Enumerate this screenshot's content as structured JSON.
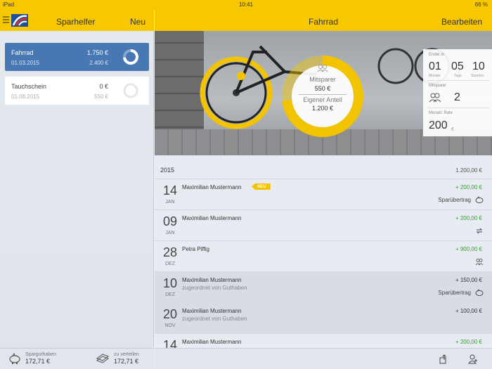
{
  "statusbar": {
    "device": "iPad",
    "wifi": "wifi-icon",
    "time": "10:41",
    "battery": "66 %"
  },
  "sidebar": {
    "title": "Sparhelfer",
    "new_button": "Neu",
    "cards": [
      {
        "name": "Fahrrad",
        "date": "01.03.2015",
        "amount": "1.750 €",
        "goal": "2.400 €",
        "progress": 0.73,
        "selected": true
      },
      {
        "name": "Tauchschein",
        "date": "01.08.2015",
        "amount": "0 €",
        "goal": "550 €",
        "progress": 0.0,
        "selected": false
      }
    ],
    "footer": {
      "savings_label": "Sparguthaben",
      "savings_value": "172,71 €",
      "distribute_label": "zu verteilen",
      "distribute_value": "172,71 €"
    }
  },
  "detail": {
    "title": "Fahrrad",
    "edit_button": "Bearbeiten",
    "hero": {
      "co_savers_label": "Mitsparer",
      "co_savers_amount": "550 €",
      "own_share_label": "Eigener Anteil",
      "own_share_amount": "1.200 €",
      "progress": 0.73
    },
    "info": {
      "ends_in_label": "Endet in",
      "months": "01",
      "months_label": "Monate",
      "days": "05",
      "days_label": "Tage",
      "hours": "10",
      "hours_label": "Stunden",
      "co_savers_label": "Mitsparer",
      "co_savers_count": "2",
      "monthly_rate_label": "Monatl. Rate",
      "monthly_rate_value": "200",
      "monthly_rate_unit": "€"
    },
    "year": {
      "label": "2015",
      "total": "1.200,00 €"
    },
    "entries": [
      {
        "day": "14",
        "month": "JAN",
        "name": "Maximilian Mustermann",
        "sub": "",
        "amount": "+ 200,00 €",
        "amount_color": "green",
        "label": "Sparübertrag",
        "icon": "piggy-bank-icon",
        "badge": "NEU",
        "shaded": false
      },
      {
        "day": "09",
        "month": "JAN",
        "name": "Maximilian Mustermann",
        "sub": "",
        "amount": "+ 200,00 €",
        "amount_color": "green",
        "label": "",
        "icon": "repeat-icon",
        "badge": "",
        "shaded": false
      },
      {
        "day": "28",
        "month": "DEZ",
        "name": "Petra Piffig",
        "sub": "",
        "amount": "+ 900,00 €",
        "amount_color": "green",
        "label": "",
        "icon": "group-icon",
        "badge": "",
        "shaded": false
      },
      {
        "day": "10",
        "month": "DEZ",
        "name": "Maximilian Mustermann",
        "sub": "zugeordnet von Guthaben",
        "amount": "+ 150,00 €",
        "amount_color": "dark",
        "label": "Sparübertrag",
        "icon": "piggy-bank-icon",
        "badge": "",
        "shaded": true
      },
      {
        "day": "20",
        "month": "NOV",
        "name": "Maximilian Mustermann",
        "sub": "zugeordnet von Guthaben",
        "amount": "+ 100,00 €",
        "amount_color": "dark",
        "label": "",
        "icon": "",
        "badge": "",
        "shaded": true
      },
      {
        "day": "14",
        "month": "",
        "name": "Maximilian Mustermann",
        "sub": "",
        "amount": "+ 200,00 €",
        "amount_color": "green",
        "label": "",
        "icon": "",
        "badge": "",
        "shaded": false
      }
    ],
    "toolbar": {
      "share_icon": "share-icon",
      "add_person_icon": "add-person-icon"
    }
  },
  "colors": {
    "accent": "#f7c700",
    "selected": "#4778b4",
    "positive": "#3f9a3f"
  }
}
